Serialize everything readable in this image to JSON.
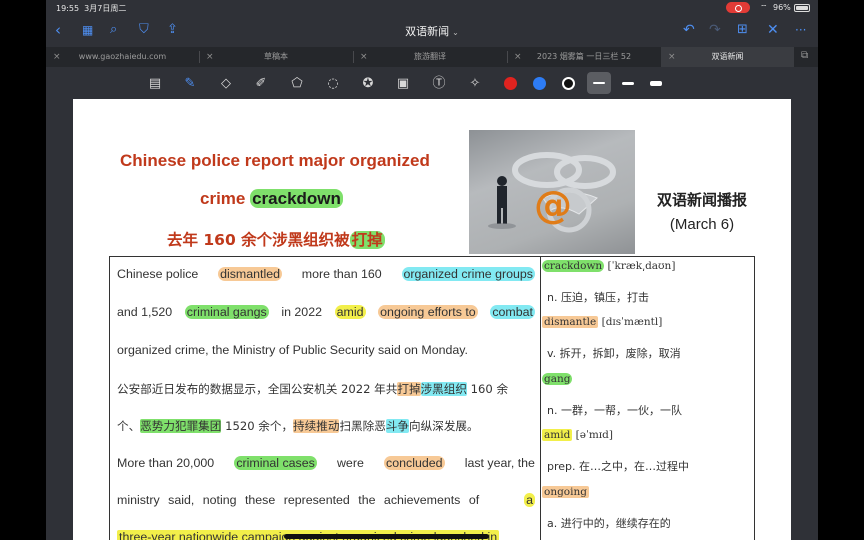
{
  "status": {
    "time": "19:55",
    "date": "3月7日周二",
    "battery": "96%"
  },
  "nav": {
    "title": "双语新闻",
    "caret": "⌄"
  },
  "tabs": [
    {
      "label": "www.gaozhaiedu.com"
    },
    {
      "label": "草稿本"
    },
    {
      "label": "旅游翻译"
    },
    {
      "label": "2023 烟雾篇 一日三栏 52"
    },
    {
      "label": "双语新闻"
    }
  ],
  "colors": {
    "red": "#e0231f",
    "blue": "#2d7cf5",
    "black": "#111111"
  },
  "title": {
    "line1": "Chinese police report major organized",
    "line2_prefix": "crime ",
    "line2_hl": "crackdown",
    "line3_prefix": "去年 160 余个涉黑组织被",
    "line3_hl": "打掉"
  },
  "heading": {
    "line1": "双语新闻播报",
    "line2": "(March 6)"
  },
  "article": {
    "l1": {
      "a": "Chinese police",
      "b": "dismantled",
      "c": "more than 160",
      "d": "organized crime groups"
    },
    "l2": {
      "a": "and 1,520",
      "b": "criminal gangs",
      "c": "in 2022",
      "d": "amid",
      "e": "ongoing efforts to",
      "f": "combat"
    },
    "l3": {
      "a": "organized crime, the Ministry of Public Security said on Monday."
    },
    "l4": {
      "a": "公安部近日发布的数据显示，全国公安机关 2022 年共",
      "b": "打掉",
      "c": "涉黑组织",
      "d": "160 余"
    },
    "l5": {
      "a": "个、",
      "b": "恶势力犯罪集团",
      "c": "1520 余个，",
      "d": "持续推动",
      "e": "扫黑除恶",
      "f": "斗争",
      "g": "向纵深发展。"
    },
    "l6": {
      "a": "More than 20,000",
      "b": "criminal cases",
      "c": "were",
      "d": "concluded",
      "e": "last year, the"
    },
    "l7": {
      "a": "ministry said, noting these represented the achievements of",
      "b": "a"
    },
    "l8": {
      "a": "three-year nationwide campaign against organized crime launched in"
    }
  },
  "vocab": [
    {
      "word": "crackdown",
      "phon": "[ˈkræk͵daʊn]",
      "def": "n. 压迫，镇压，打击"
    },
    {
      "word": "dismantle",
      "phon": "[dɪsˈmæntl]",
      "def": "v. 拆开，拆卸，废除，取消"
    },
    {
      "word": "gang",
      "phon": "",
      "def": "n. 一群，一帮，一伙，一队"
    },
    {
      "word": "amid",
      "phon": "[əˈmɪd]",
      "def": "prep. 在…之中，在…过程中"
    },
    {
      "word": "ongoing",
      "phon": "",
      "def": "a. 进行中的，继续存在的"
    }
  ]
}
